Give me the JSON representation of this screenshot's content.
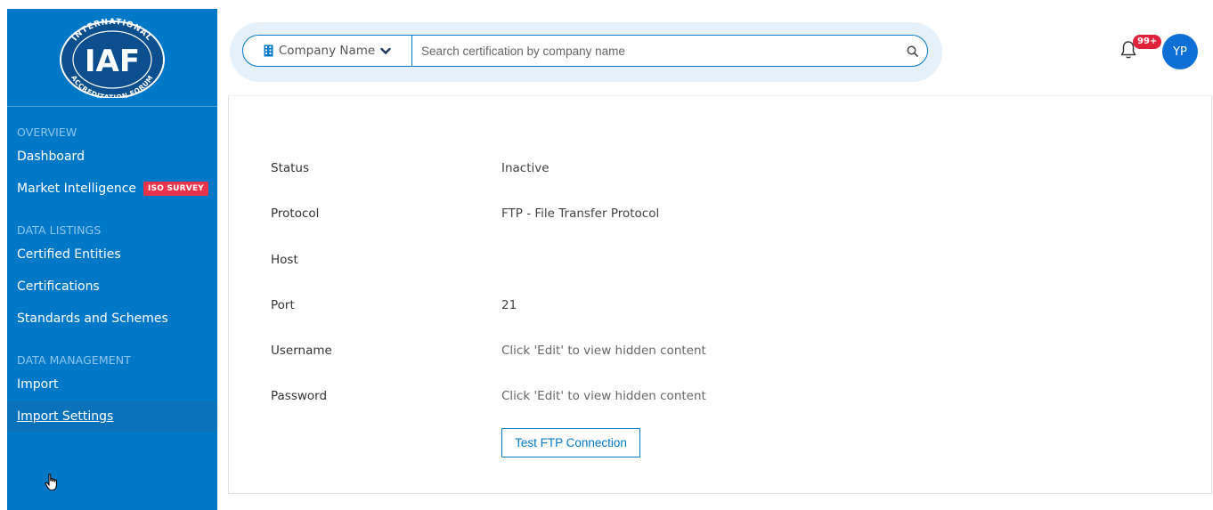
{
  "logo": {
    "top_text": "INTERNATIONAL",
    "main_text": "IAF",
    "bottom_text": "ACCREDITATION FORUM"
  },
  "sidebar": {
    "sections": [
      {
        "heading": "OVERVIEW",
        "items": [
          {
            "label": "Dashboard"
          },
          {
            "label": "Market Intelligence",
            "badge": "ISO SURVEY"
          }
        ]
      },
      {
        "heading": "DATA LISTINGS",
        "items": [
          {
            "label": "Certified Entities"
          },
          {
            "label": "Certifications"
          },
          {
            "label": "Standards and Schemes"
          }
        ]
      },
      {
        "heading": "DATA MANAGEMENT",
        "items": [
          {
            "label": "Import"
          },
          {
            "label": "Import Settings",
            "active": true
          }
        ]
      }
    ]
  },
  "search": {
    "filter_label": "Company Name",
    "placeholder": "Search certification by company name",
    "value": ""
  },
  "header": {
    "notification_count": "99+",
    "avatar_initials": "YP"
  },
  "details": [
    {
      "label": "Status",
      "value": "Inactive"
    },
    {
      "label": "Protocol",
      "value": "FTP - File Transfer Protocol"
    },
    {
      "label": "Host",
      "value": ""
    },
    {
      "label": "Port",
      "value": "21"
    },
    {
      "label": "Username",
      "value": "Click 'Edit' to view hidden content"
    },
    {
      "label": "Password",
      "value": "Click 'Edit' to view hidden content"
    }
  ],
  "actions": {
    "test_button_label": "Test FTP Connection"
  },
  "colors": {
    "sidebar": "#0078c8",
    "accent": "#0078c8",
    "badge": "#e8334a",
    "avatar": "#0e6fd6"
  }
}
